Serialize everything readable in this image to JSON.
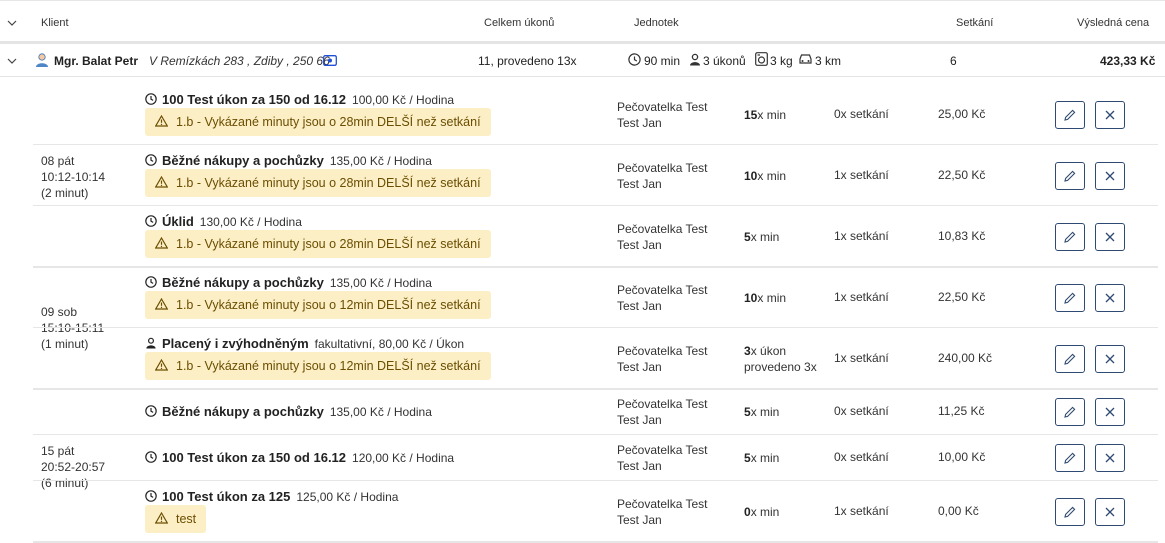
{
  "header": {
    "col_client": "Klient",
    "col_total": "Celkem úkonů",
    "col_units": "Jednotek",
    "col_meetings": "Setkání",
    "col_price": "Výsledná cena"
  },
  "client": {
    "name": "Mgr. Balat Petr",
    "address": "V Remízkách 283 , Zdiby , 250 66",
    "total": "11, provedeno 13x",
    "minutes": "90 min",
    "acts": "3 úkonů",
    "weight": "3 kg",
    "km": "3 km",
    "meetings": "6",
    "price": "423,33 Kč"
  },
  "groups": [
    {
      "line1": "08 pát",
      "line2": "10:12-10:14",
      "line3": "(2 minut)"
    },
    {
      "line1": "09 sob",
      "line2": "15:10-15:11",
      "line3": "(1 minut)"
    },
    {
      "line1": "15 pát",
      "line2": "20:52-20:57",
      "line3": "(6 minut)"
    }
  ],
  "rows": [
    {
      "name": "100 Test úkon za 150 od 16.12",
      "price": "100,00 Kč / Hodina",
      "warning": "1.b - Vykázané minuty jsou o 28min DELŠÍ než setkání",
      "worker1": "Pečovatelka Test",
      "worker2": "Test Jan",
      "units_num": "15",
      "units_text": "x min",
      "meetings": "0x setkání",
      "total": "25,00 Kč"
    },
    {
      "name": "Běžné nákupy a pochůzky",
      "price": "135,00 Kč / Hodina",
      "warning": "1.b - Vykázané minuty jsou o 28min DELŠÍ než setkání",
      "worker1": "Pečovatelka Test",
      "worker2": "Test Jan",
      "units_num": "10",
      "units_text": "x min",
      "meetings": "1x setkání",
      "total": "22,50 Kč"
    },
    {
      "name": "Úklid",
      "price": "130,00 Kč / Hodina",
      "warning": "1.b - Vykázané minuty jsou o 28min DELŠÍ než setkání",
      "worker1": "Pečovatelka Test",
      "worker2": "Test Jan",
      "units_num": "5",
      "units_text": "x min",
      "meetings": "1x setkání",
      "total": "10,83 Kč"
    },
    {
      "name": "Běžné nákupy a pochůzky",
      "price": "135,00 Kč / Hodina",
      "warning": "1.b - Vykázané minuty jsou o 12min DELŠÍ než setkání",
      "worker1": "Pečovatelka Test",
      "worker2": "Test Jan",
      "units_num": "10",
      "units_text": "x min",
      "meetings": "1x setkání",
      "total": "22,50 Kč"
    },
    {
      "name": "Placený i zvýhodněným",
      "price": "fakultativní, 80,00 Kč / Úkon",
      "warning": "1.b - Vykázané minuty jsou o 12min DELŠÍ než setkání",
      "worker1": "Pečovatelka Test",
      "worker2": "Test Jan",
      "units_num": "3",
      "units_text": "x úkon",
      "units_line2": "provedeno 3x",
      "meetings": "1x setkání",
      "total": "240,00 Kč"
    },
    {
      "name": "Běžné nákupy a pochůzky",
      "price": "135,00 Kč / Hodina",
      "worker1": "Pečovatelka Test",
      "worker2": "Test Jan",
      "units_num": "5",
      "units_text": "x min",
      "meetings": "0x setkání",
      "total": "11,25 Kč"
    },
    {
      "name": "100 Test úkon za 150 od 16.12",
      "price": "120,00 Kč / Hodina",
      "worker1": "Pečovatelka Test",
      "worker2": "Test Jan",
      "units_num": "5",
      "units_text": "x min",
      "meetings": "0x setkání",
      "total": "10,00 Kč"
    },
    {
      "name": "100 Test úkon za 125",
      "price": "125,00 Kč / Hodina",
      "warning": "test",
      "worker1": "Pečovatelka Test",
      "worker2": "Test Jan",
      "units_num": "0",
      "units_text": "x min",
      "meetings": "1x setkání",
      "total": "0,00 Kč"
    }
  ],
  "colors": {
    "warning_bg": "#fcefc6",
    "button_border": "#2f4a72",
    "accent_icon": "#1f4fd6"
  },
  "icons": [
    "chevron-down-icon",
    "user-icon",
    "id-card-icon",
    "clock-icon",
    "person-icon",
    "washer-icon",
    "car-icon",
    "warning-icon",
    "edit-icon",
    "close-icon"
  ]
}
